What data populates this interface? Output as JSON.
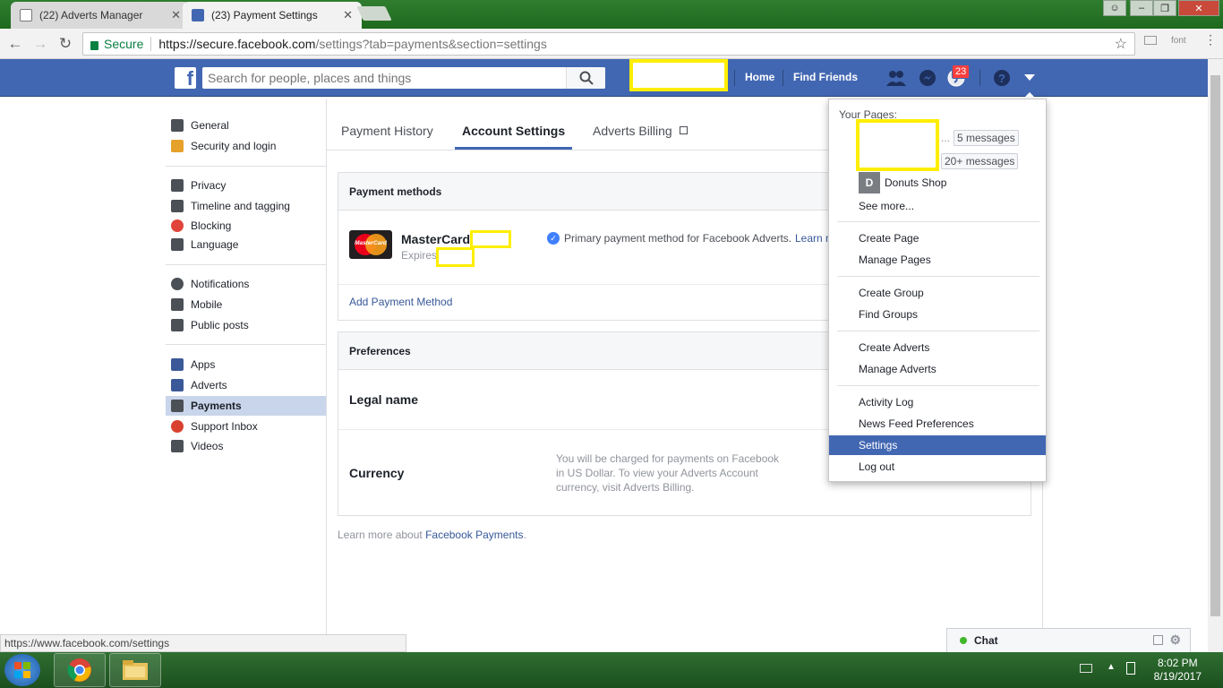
{
  "browser": {
    "tabs": [
      {
        "title": "(22) Adverts Manager",
        "close": "✕"
      },
      {
        "title": "(23) Payment Settings",
        "close": "✕"
      }
    ],
    "address": {
      "secure_label": "Secure",
      "url_host": "https://secure.facebook.com",
      "url_path": "/settings?tab=payments&section=settings"
    },
    "extension_label": "font",
    "status_url": "https://www.facebook.com/settings"
  },
  "fb": {
    "search_placeholder": "Search for people, places and things",
    "nav": {
      "home": "Home",
      "find_friends": "Find Friends"
    },
    "notifications_badge": "23",
    "colors": {
      "brand": "#4267b2",
      "redaction": "#ffee00",
      "selected_bg": "#c9d5ea"
    }
  },
  "sidebar": {
    "items": [
      {
        "label": "General",
        "icon": "gear-icon"
      },
      {
        "label": "Security and login",
        "icon": "shield-icon"
      },
      {
        "label": "Privacy",
        "icon": "lock-icon"
      },
      {
        "label": "Timeline and tagging",
        "icon": "timeline-icon"
      },
      {
        "label": "Blocking",
        "icon": "block-icon"
      },
      {
        "label": "Language",
        "icon": "language-icon"
      },
      {
        "label": "Notifications",
        "icon": "globe-icon"
      },
      {
        "label": "Mobile",
        "icon": "mobile-icon"
      },
      {
        "label": "Public posts",
        "icon": "public-posts-icon"
      },
      {
        "label": "Apps",
        "icon": "apps-icon"
      },
      {
        "label": "Adverts",
        "icon": "adverts-icon"
      },
      {
        "label": "Payments",
        "icon": "payments-icon"
      },
      {
        "label": "Support Inbox",
        "icon": "support-icon"
      },
      {
        "label": "Videos",
        "icon": "videos-icon"
      }
    ]
  },
  "main": {
    "tabs": [
      {
        "label": "Payment History"
      },
      {
        "label": "Account Settings"
      },
      {
        "label": "Adverts Billing"
      }
    ],
    "payment_methods": {
      "title": "Payment methods",
      "card_brand": "MasterCard",
      "card_logo_text": "MasterCard",
      "expires_label": "Expires",
      "primary_text": "Primary payment method for Facebook Adverts.",
      "learn_more_cut": "Learn m",
      "add_method": "Add Payment Method"
    },
    "preferences": {
      "title": "Preferences",
      "legal_name": "Legal name",
      "currency": "Currency",
      "currency_note": [
        "You will be charged for payments on Facebook",
        "in US Dollar. To view your Adverts Account",
        "currency, visit Adverts Billing."
      ]
    },
    "footer": {
      "prefix": "Learn more about ",
      "link": "Facebook Payments",
      "suffix": "."
    }
  },
  "dropdown": {
    "your_pages": "Your Pages:",
    "ellipsis": "...",
    "page_messages": [
      "5 messages",
      "20+ messages"
    ],
    "donuts_avatar": "D",
    "donuts_name": "Donuts Shop",
    "see_more": "See more...",
    "groups": [
      [
        "Create Page",
        "Manage Pages"
      ],
      [
        "Create Group",
        "Find Groups"
      ],
      [
        "Create Adverts",
        "Manage Adverts"
      ],
      [
        "Activity Log",
        "News Feed Preferences",
        "Settings",
        "Log out"
      ]
    ]
  },
  "chat": {
    "label": "Chat"
  },
  "taskbar": {
    "time": "8:02 PM",
    "date": "8/19/2017"
  }
}
